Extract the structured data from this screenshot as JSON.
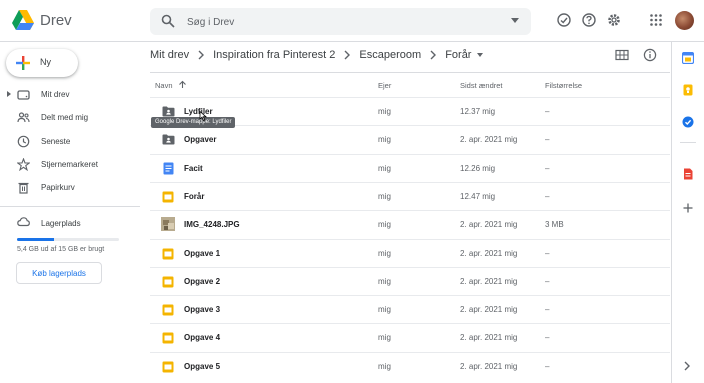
{
  "app": {
    "name": "Drev"
  },
  "search": {
    "placeholder": "Søg i Drev"
  },
  "sidebar": {
    "new_label": "Ny",
    "items": [
      {
        "label": "Mit drev",
        "icon": "drive-icon"
      },
      {
        "label": "Delt med mig",
        "icon": "people-icon"
      },
      {
        "label": "Seneste",
        "icon": "clock-icon"
      },
      {
        "label": "Stjernemarkeret",
        "icon": "star-icon"
      },
      {
        "label": "Papirkurv",
        "icon": "trash-icon"
      }
    ],
    "storage_label": "Lagerplads",
    "storage_text": "5,4 GB ud af 15 GB er brugt",
    "storage_used_fraction": 0.36,
    "buy_label": "Køb lagerplads"
  },
  "breadcrumb": [
    "Mit drev",
    "Inspiration fra Pinterest 2",
    "Escaperoom",
    "Forår"
  ],
  "table": {
    "headers": {
      "name": "Navn",
      "owner": "Ejer",
      "modified": "Sidst ændret",
      "size": "Filstørrelse"
    },
    "rows": [
      {
        "name": "Lydfiler",
        "type": "shared-folder",
        "owner": "mig",
        "modified": "12.37 mig",
        "size": "–"
      },
      {
        "name": "Opgaver",
        "type": "shared-folder",
        "owner": "mig",
        "modified": "2. apr. 2021 mig",
        "size": "–"
      },
      {
        "name": "Facit",
        "type": "doc",
        "owner": "mig",
        "modified": "12.26 mig",
        "size": "–"
      },
      {
        "name": "Forår",
        "type": "slides",
        "owner": "mig",
        "modified": "12.47 mig",
        "size": "–"
      },
      {
        "name": "IMG_4248.JPG",
        "type": "image",
        "owner": "mig",
        "modified": "2. apr. 2021 mig",
        "size": "3 MB"
      },
      {
        "name": "Opgave 1",
        "type": "slides",
        "owner": "mig",
        "modified": "2. apr. 2021 mig",
        "size": "–"
      },
      {
        "name": "Opgave 2",
        "type": "slides",
        "owner": "mig",
        "modified": "2. apr. 2021 mig",
        "size": "–"
      },
      {
        "name": "Opgave 3",
        "type": "slides",
        "owner": "mig",
        "modified": "2. apr. 2021 mig",
        "size": "–"
      },
      {
        "name": "Opgave 4",
        "type": "slides",
        "owner": "mig",
        "modified": "2. apr. 2021 mig",
        "size": "–"
      },
      {
        "name": "Opgave 5",
        "type": "slides",
        "owner": "mig",
        "modified": "2. apr. 2021 mig",
        "size": "–"
      }
    ]
  },
  "tooltip": "Google Drev-mappe: Lydfiler",
  "colors": {
    "accent": "#1a73e8",
    "folder": "#5f6368",
    "doc": "#4285f4",
    "slides": "#f4b400"
  }
}
